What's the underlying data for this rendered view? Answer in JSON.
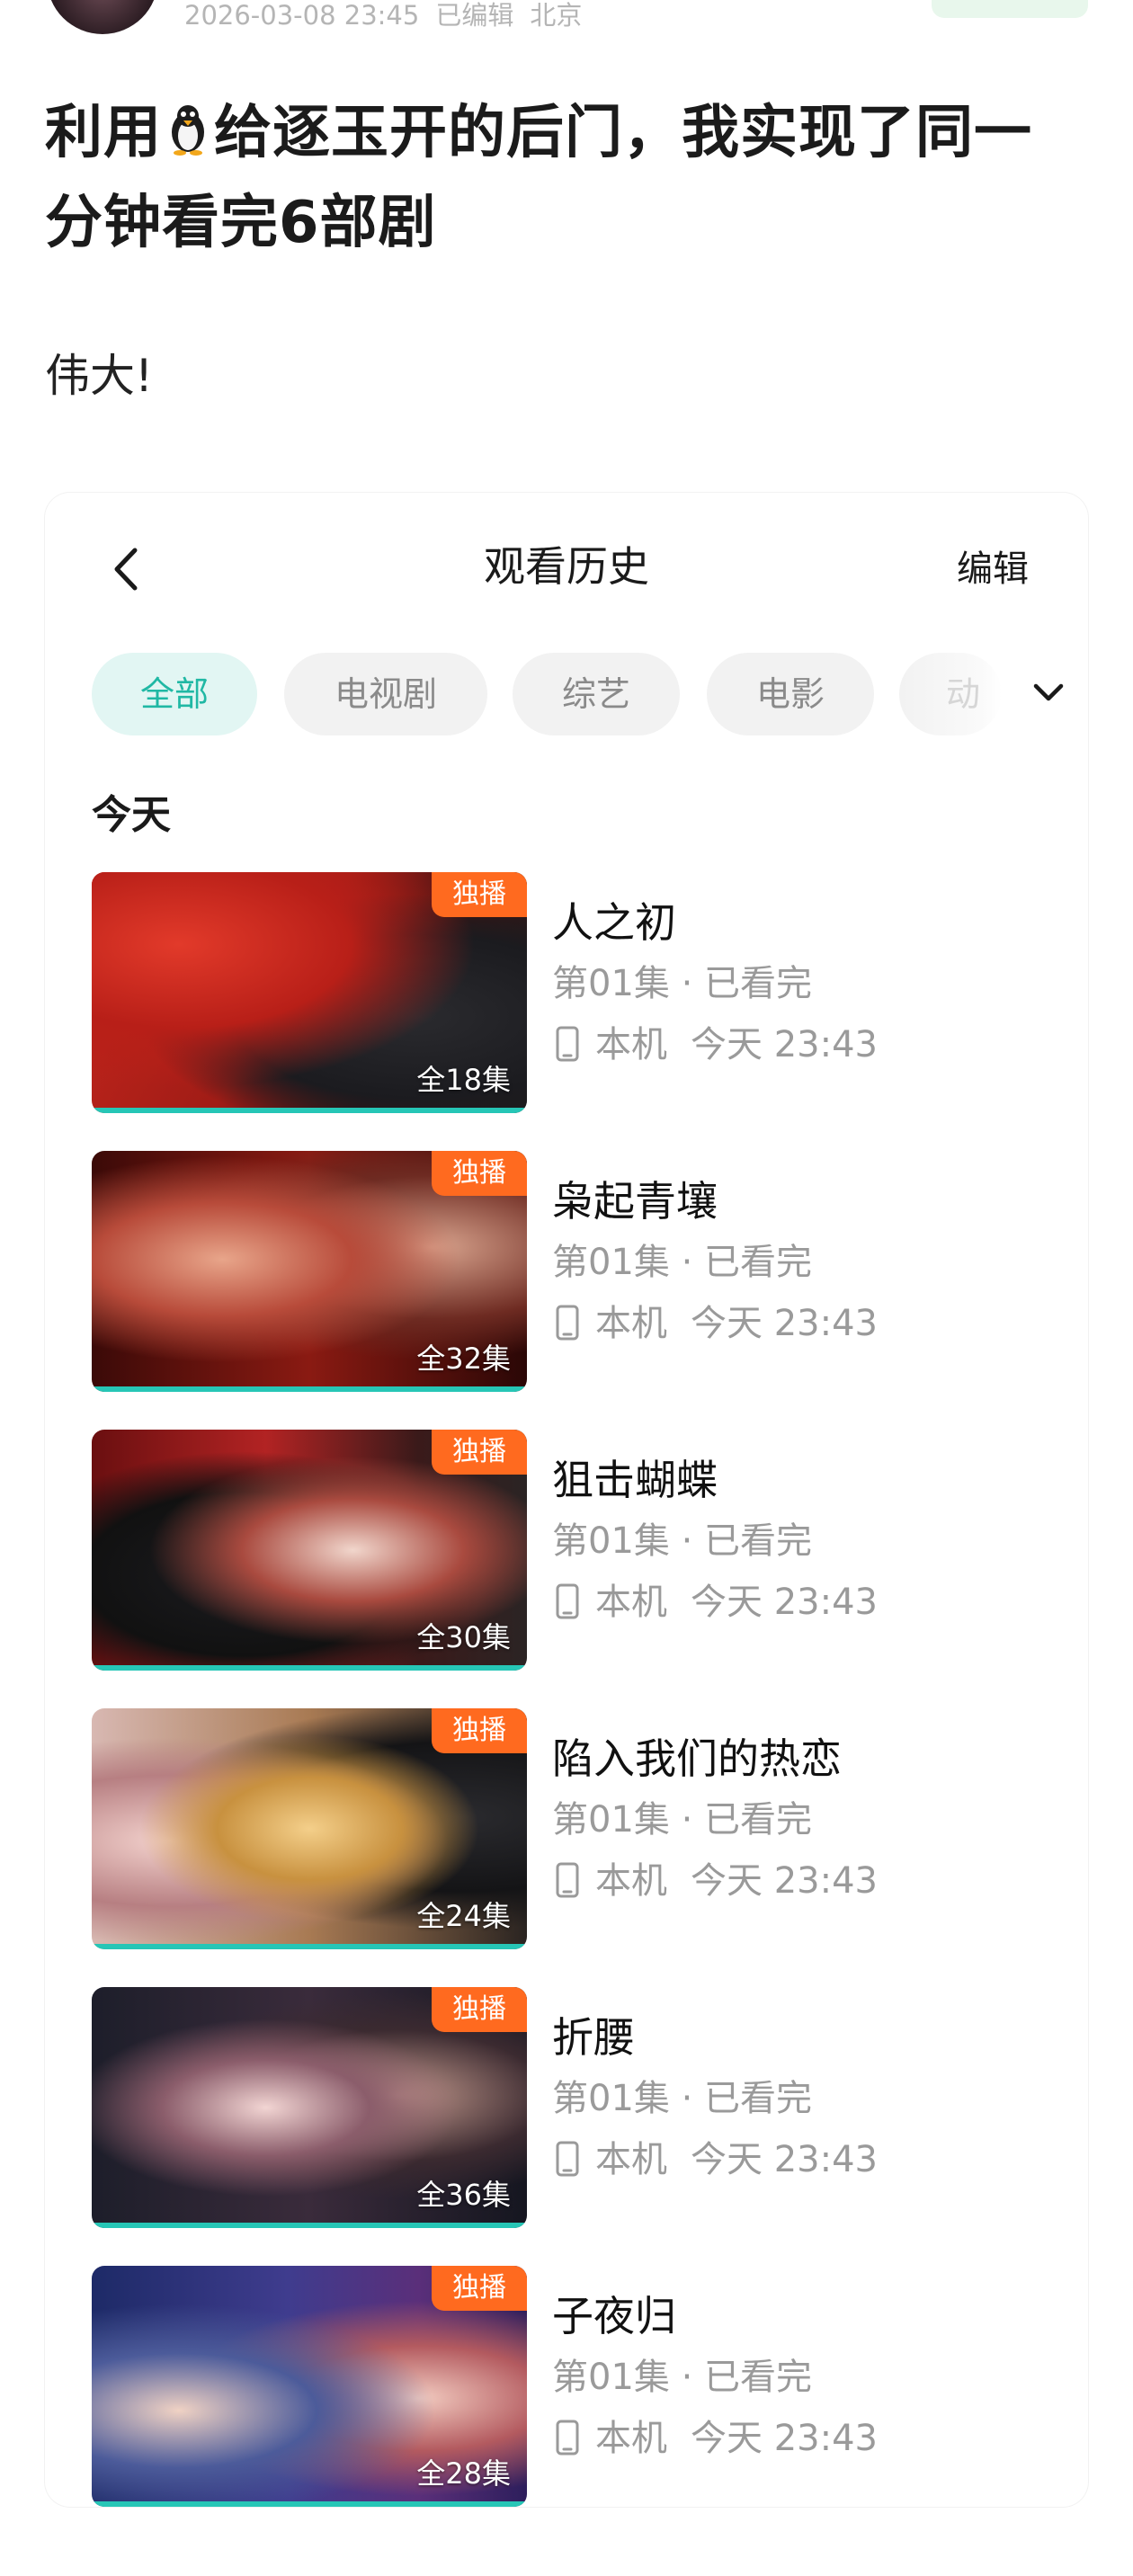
{
  "post": {
    "timestamp": "2026-03-08 23:45",
    "edited": "已编辑",
    "location": "北京",
    "title_before": "利用",
    "title_after": "给逐玉开的后门，我实现了同一分钟看完6部剧",
    "body": "伟大!"
  },
  "screenshot": {
    "nav": {
      "title": "观看历史",
      "edit_label": "编辑"
    },
    "filters": [
      {
        "label": "全部",
        "active": true
      },
      {
        "label": "电视剧",
        "active": false
      },
      {
        "label": "综艺",
        "active": false
      },
      {
        "label": "电影",
        "active": false
      },
      {
        "label": "动",
        "active": false
      }
    ],
    "section": "今天",
    "items": [
      {
        "title": "人之初",
        "badge": "独播",
        "episodes": "全18集",
        "progress": "第01集 · 已看完",
        "device": "本机",
        "time": "今天 23:43"
      },
      {
        "title": "枭起青壤",
        "badge": "独播",
        "episodes": "全32集",
        "progress": "第01集 · 已看完",
        "device": "本机",
        "time": "今天 23:43"
      },
      {
        "title": "狙击蝴蝶",
        "badge": "独播",
        "episodes": "全30集",
        "progress": "第01集 · 已看完",
        "device": "本机",
        "time": "今天 23:43"
      },
      {
        "title": "陷入我们的热恋",
        "badge": "独播",
        "episodes": "全24集",
        "progress": "第01集 · 已看完",
        "device": "本机",
        "time": "今天 23:43"
      },
      {
        "title": "折腰",
        "badge": "独播",
        "episodes": "全36集",
        "progress": "第01集 · 已看完",
        "device": "本机",
        "time": "今天 23:43"
      },
      {
        "title": "子夜归",
        "badge": "独播",
        "episodes": "全28集",
        "progress": "第01集 · 已看完",
        "device": "本机",
        "time": "今天 23:43"
      }
    ]
  },
  "colors": {
    "accent": "#20b8a4",
    "badge": "#ff6a1f",
    "progress_bar": "#26c6b6"
  }
}
